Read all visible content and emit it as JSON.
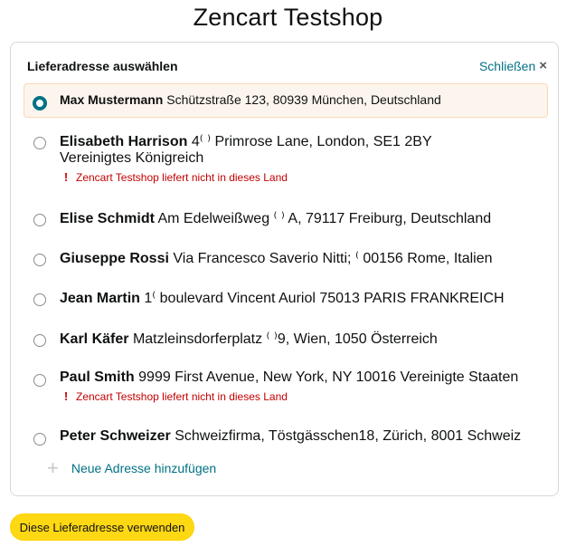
{
  "header": {
    "title": "Zencart Testshop"
  },
  "panel": {
    "title": "Lieferadresse auswählen",
    "close_label": "Schließen",
    "close_icon": "×"
  },
  "addresses": [
    {
      "name": "Max Mustermann",
      "line1": "Schützstraße 123, 80939 München, Deutschland",
      "selected": true
    },
    {
      "name": "Elisabeth Harrison",
      "line1": "4⁽ ⁾ Primrose Lane, London, SE1 2BY",
      "line2": "Vereinigtes Königreich",
      "warning": "Zencart Testshop liefert nicht in dieses Land",
      "selected": false
    },
    {
      "name": "Elise Schmidt",
      "line1": "Am Edelweißweg ⁽ ⁾ A, 79117 Freiburg, Deutschland",
      "selected": false
    },
    {
      "name": "Giuseppe Rossi",
      "line1": "Via Francesco Saverio Nitti; ⁽ 00156 Rome, Italien",
      "selected": false
    },
    {
      "name": "Jean Martin",
      "line1": "1⁽ boulevard Vincent Auriol 75013 PARIS FRANKREICH",
      "selected": false
    },
    {
      "name": "Karl Käfer",
      "line1": "Matzleinsdorferplatz ⁽ ⁾9, Wien, 1050 Österreich",
      "selected": false
    },
    {
      "name": "Paul Smith",
      "line1": "9999 First Avenue, New York, NY 10016 Vereinigte Staaten",
      "warning": "Zencart Testshop liefert nicht in dieses Land",
      "selected": false
    },
    {
      "name": "Peter Schweizer",
      "line1": "Schweizfirma, Töstgässchen18, Zürich, 8001 Schweiz",
      "selected": false
    }
  ],
  "add_address": {
    "icon": "+",
    "label": "Neue Adresse hinzufügen"
  },
  "footer": {
    "use_button_label": "Diese Lieferadresse verwenden"
  },
  "colors": {
    "link": "#007185",
    "warning": "#c40000",
    "selected_bg": "#fcf5ee",
    "selected_border": "#fbd8b4",
    "button_bg": "#ffd814"
  }
}
